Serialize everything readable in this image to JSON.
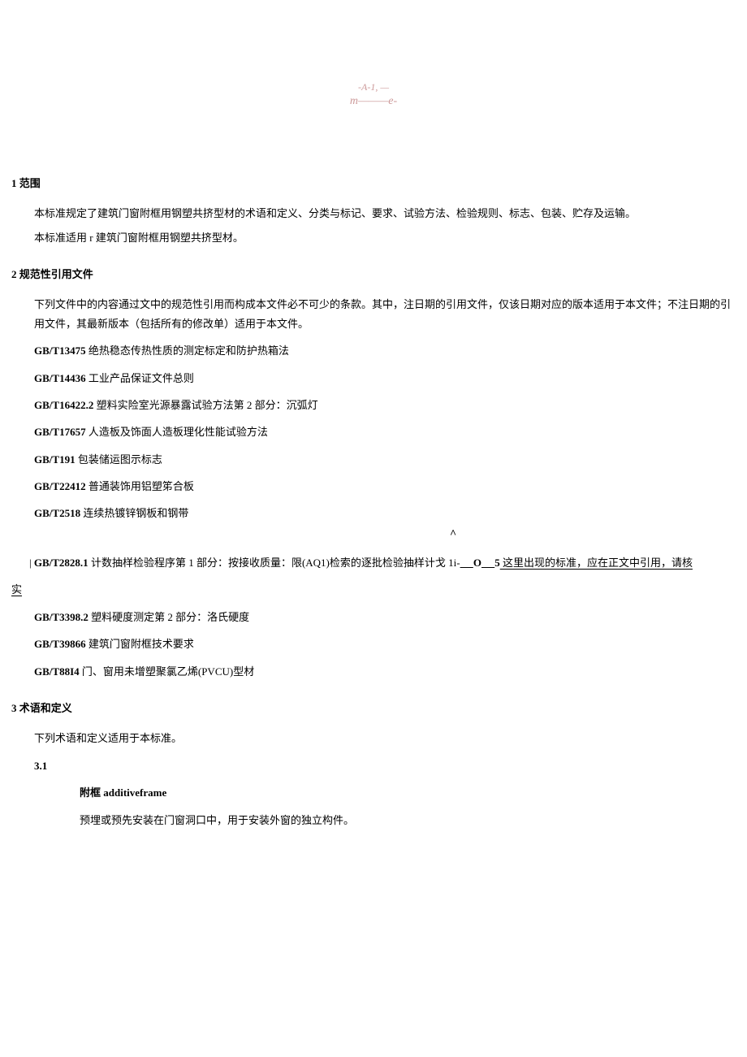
{
  "decoration": {
    "line1": "-A-1,        —",
    "line2": "m———e-"
  },
  "sections": {
    "s1": {
      "heading": "1 范围",
      "p1": "本标准规定了建筑门窗附框用钢塑共挤型材的术语和定义、分类与标记、要求、试验方法、检验规则、标志、包装、贮存及运输。",
      "p2": "本标准适用 r 建筑门窗附框用钢塑共挤型材。"
    },
    "s2": {
      "heading": "2 规范性引用文件",
      "p1": "下列文件中的内容通过文中的规范性引用而构成本文件必不可少的条款。其中，注日期的引用文件，仅该日期对应的版本适用于本文件；不注日期的引用文件，其最新版本（包括所有的修改单）适用于本文件。",
      "refs": {
        "r1": {
          "code": "GB/T13475",
          "title": " 绝热稳态传热性质的测定标定和防护热箱法"
        },
        "r2": {
          "code": "GB/T14436",
          "title": " 工业产品保证文件总则"
        },
        "r3": {
          "code": "GB/T16422.2",
          "title": " 塑料实险室光源暴露试验方法第 2 部分：沉弧灯"
        },
        "r4": {
          "code": "GB/T17657",
          "title": " 人造板及饰面人造板理化性能试验方法"
        },
        "r5": {
          "code": "GB/T191",
          "title": " 包装储运图示标志"
        },
        "r6": {
          "code": "GB/T22412",
          "title": " 普通装饰用铝塑笫合板"
        },
        "r7": {
          "code": "GB/T2518",
          "title": " 连续热镀锌钢板和钢带"
        }
      },
      "special": {
        "bar": "|",
        "code": "GB/T2828.1",
        "title": " 计数抽样检验程序第 1 部分：按接收质量：限(AQ1)检索的逐批检验抽样计戈 1i-",
        "caret": "^",
        "circle": "O",
        "five": "5",
        "annotation": " 这里出现的标准，应在正文中引用，请核",
        "verify": "实"
      },
      "refs2": {
        "r8": {
          "code": "GB/T3398.2",
          "title": " 塑料硬度测定第 2 部分：洛氏硬度"
        },
        "r9": {
          "code": "GB/T39866",
          "title": " 建筑门窗附框技术要求"
        },
        "r10": {
          "code": "GB/T88I4",
          "title": " 门、窗用未增塑聚氯乙烯(PVCU)型材"
        }
      }
    },
    "s3": {
      "heading": "3 术语和定义",
      "p1": "下列术语和定义适用于本标准。",
      "term1": {
        "num": "3.1",
        "name_cn": "附框",
        "name_en": " additiveframe",
        "def": "预埋或预先安装在门窗洞口中，用于安装外窗的独立构件。"
      }
    }
  }
}
